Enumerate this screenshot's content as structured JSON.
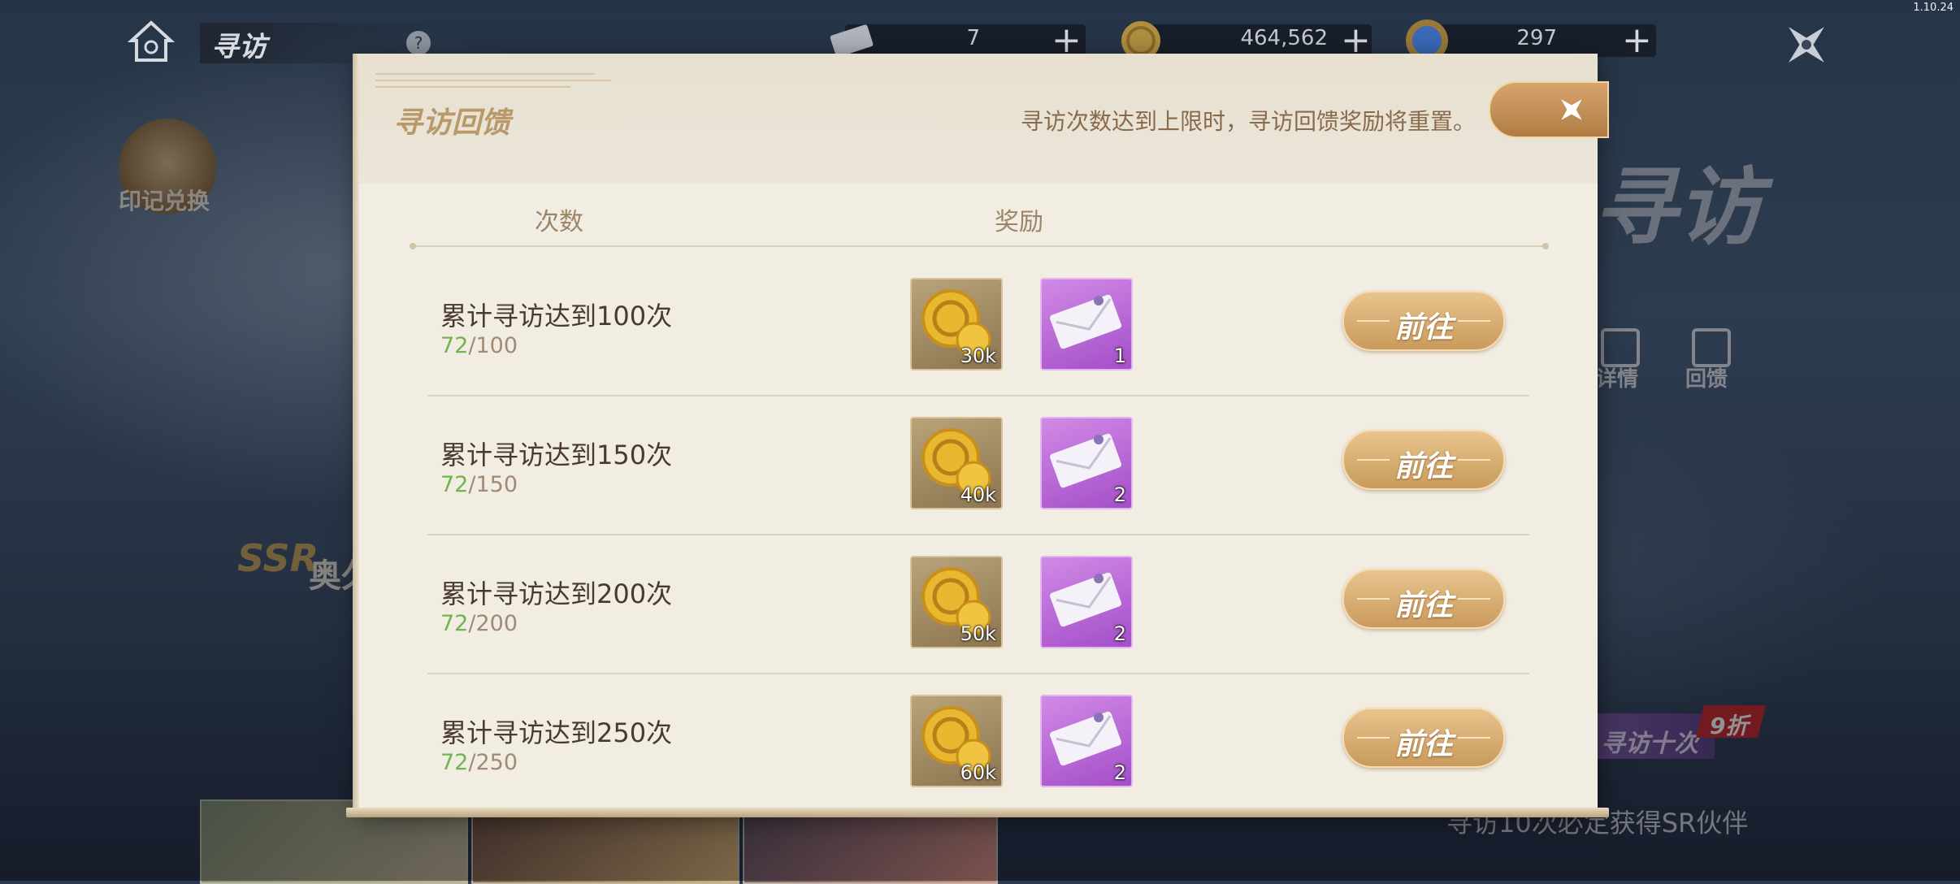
{
  "version": "1.10.24",
  "topbar": {
    "title": "寻访",
    "help_glyph": "?",
    "resources": [
      {
        "icon": "ticket-icon",
        "value": "7"
      },
      {
        "icon": "gold-coin-icon",
        "value": "464,562"
      },
      {
        "icon": "gem-orb-icon",
        "value": "297"
      }
    ],
    "plus_glyph": "+"
  },
  "background": {
    "stamp_exchange_label": "印记兑换",
    "page_title": "寻访",
    "details_label": "详情",
    "feedback_label": "回馈",
    "ssr_label": "SSR",
    "ssr_name": "奥久",
    "ten_pull_label": "寻访十次",
    "discount_badge": "9折",
    "sr_hint": "寻访10次必定获得SR伙伴"
  },
  "modal": {
    "title": "寻访回馈",
    "note": "寻访次数达到上限时，寻访回馈奖励将重置。",
    "col_count": "次数",
    "col_reward": "奖励",
    "go_label": "前往",
    "rows": [
      {
        "title": "累计寻访达到100次",
        "current": "72",
        "target": "/100",
        "gold_qty": "30k",
        "ticket_qty": "1"
      },
      {
        "title": "累计寻访达到150次",
        "current": "72",
        "target": "/150",
        "gold_qty": "40k",
        "ticket_qty": "2"
      },
      {
        "title": "累计寻访达到200次",
        "current": "72",
        "target": "/200",
        "gold_qty": "50k",
        "ticket_qty": "2"
      },
      {
        "title": "累计寻访达到250次",
        "current": "72",
        "target": "/250",
        "gold_qty": "60k",
        "ticket_qty": "2"
      }
    ]
  },
  "colors": {
    "accent_gold": "#c99a5c",
    "progress_current": "#6fb44c",
    "reward_purple": "#a44ec8"
  }
}
